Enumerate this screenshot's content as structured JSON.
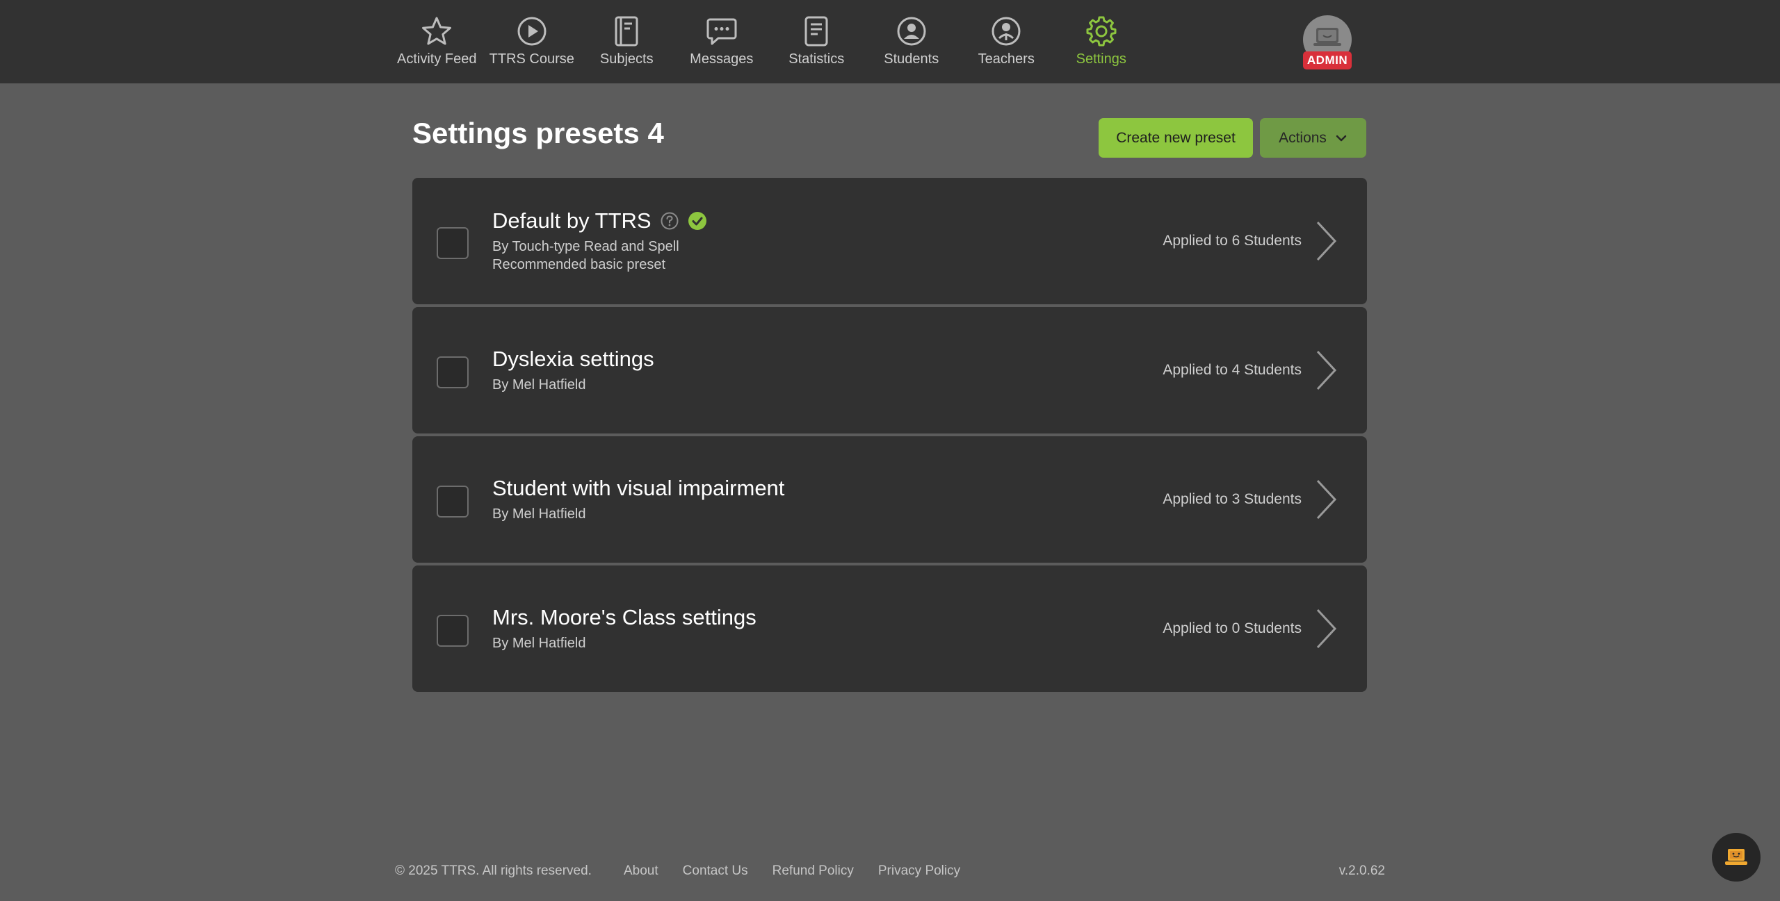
{
  "nav": {
    "items": [
      {
        "label": "Activity Feed",
        "icon": "star-icon"
      },
      {
        "label": "TTRS Course",
        "icon": "play-circle-icon"
      },
      {
        "label": "Subjects",
        "icon": "book-icon"
      },
      {
        "label": "Messages",
        "icon": "chat-bubble-icon"
      },
      {
        "label": "Statistics",
        "icon": "document-icon"
      },
      {
        "label": "Students",
        "icon": "user-circle-icon"
      },
      {
        "label": "Teachers",
        "icon": "teacher-icon"
      },
      {
        "label": "Settings",
        "icon": "gear-icon",
        "active": true
      }
    ],
    "admin_badge": "ADMIN"
  },
  "page": {
    "title": "Settings presets 4",
    "create_label": "Create new preset",
    "actions_label": "Actions"
  },
  "presets": [
    {
      "name": "Default by TTRS",
      "author": "By Touch-type Read and Spell",
      "note": "Recommended basic preset",
      "applied": "Applied to 6 Students"
    },
    {
      "name": "Dyslexia settings",
      "author": "By Mel Hatfield",
      "applied": "Applied to 4 Students"
    },
    {
      "name": "Student with visual impairment",
      "author": "By Mel Hatfield",
      "applied": "Applied to 3 Students"
    },
    {
      "name": "Mrs. Moore's Class settings",
      "author": "By Mel Hatfield",
      "applied": "Applied to 0 Students"
    }
  ],
  "footer": {
    "copyright": "© 2025 TTRS. All rights reserved.",
    "links": [
      "About",
      "Contact Us",
      "Refund Policy",
      "Privacy Policy"
    ],
    "version": "v.2.0.62"
  },
  "colors": {
    "accent": "#8dc63f",
    "nav_bg": "#323232",
    "page_bg": "#5c5c5c",
    "card_bg": "#313131",
    "admin_red": "#d9303a"
  }
}
